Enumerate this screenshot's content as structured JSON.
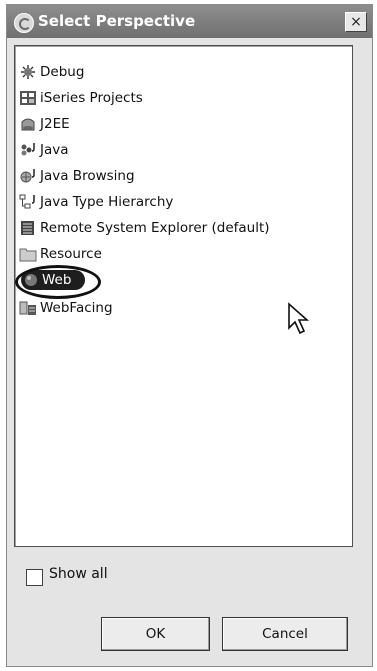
{
  "dialog": {
    "title": "Select Perspective",
    "close_label": "×",
    "title_icon": "perspective-icon"
  },
  "perspectives": [
    {
      "label": "Debug",
      "icon": "debug-icon"
    },
    {
      "label": "iSeries Projects",
      "icon": "iseries-projects-icon"
    },
    {
      "label": "J2EE",
      "icon": "j2ee-icon"
    },
    {
      "label": "Java",
      "icon": "java-icon"
    },
    {
      "label": "Java Browsing",
      "icon": "java-browsing-icon"
    },
    {
      "label": "Java Type Hierarchy",
      "icon": "java-type-hierarchy-icon"
    },
    {
      "label": "Remote System Explorer (default)",
      "icon": "remote-system-explorer-icon"
    },
    {
      "label": "Resource",
      "icon": "resource-icon"
    },
    {
      "label": "Web",
      "icon": "web-icon",
      "selected": true
    },
    {
      "label": "WebFacing",
      "icon": "webfacing-icon"
    }
  ],
  "show_all": {
    "label": "Show all",
    "checked": false
  },
  "buttons": {
    "ok": "OK",
    "cancel": "Cancel"
  }
}
